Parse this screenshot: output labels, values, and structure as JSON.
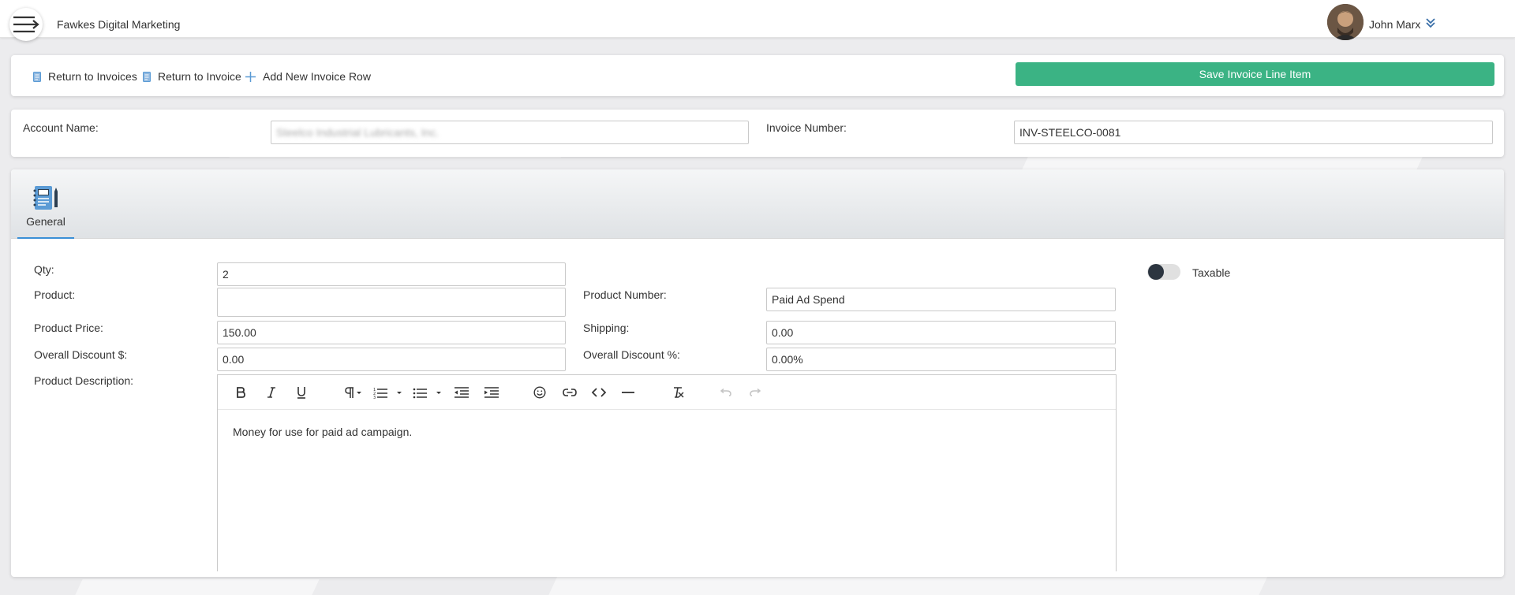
{
  "header": {
    "company": "Fawkes Digital Marketing",
    "user_name": "John Marx"
  },
  "toolbar": {
    "return_invoices": "Return to Invoices",
    "return_invoice": "Return to Invoice",
    "add_row": "Add New Invoice Row",
    "save_label": "Save Invoice Line Item"
  },
  "account": {
    "account_label": "Account Name:",
    "account_value": "Steelco Industrial Lubricants, Inc.",
    "invoice_label": "Invoice Number:",
    "invoice_value": "INV-STEELCO-0081"
  },
  "tabs": [
    {
      "label": "General",
      "icon": "notebook-icon",
      "active": true
    }
  ],
  "form": {
    "qty_label": "Qty:",
    "qty_value": "2",
    "product_label": "Product:",
    "product_value": "",
    "product_number_label": "Product Number:",
    "product_number_value": "Paid Ad Spend",
    "price_label": "Product Price:",
    "price_value": "150.00",
    "shipping_label": "Shipping:",
    "shipping_value": "0.00",
    "discount_amt_label": "Overall Discount $:",
    "discount_amt_value": "0.00",
    "discount_pct_label": "Overall Discount %:",
    "discount_pct_value": "0.00%",
    "description_label": "Product Description:",
    "description_value": "Money for use for paid ad campaign.",
    "taxable_label": "Taxable",
    "taxable_on": false
  },
  "colors": {
    "save_button": "#3bb384",
    "icon_blue": "#5b9bd5",
    "toggle_knob": "#2c3540"
  }
}
